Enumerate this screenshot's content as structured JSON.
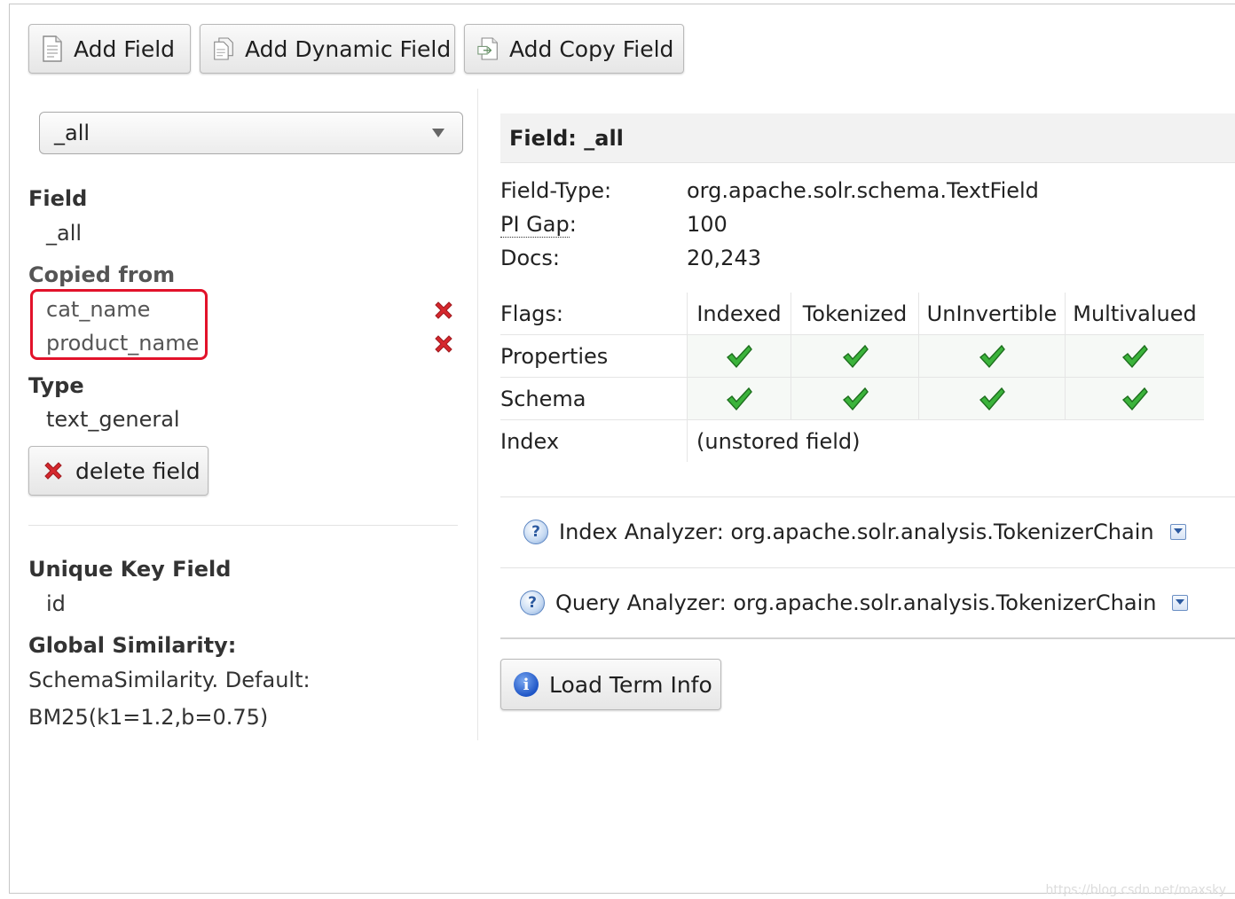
{
  "toolbar": {
    "add_field": "Add Field",
    "add_dynamic_field": "Add Dynamic Field",
    "add_copy_field": "Add Copy Field"
  },
  "field_select": {
    "selected": "_all"
  },
  "left": {
    "field_label": "Field",
    "field_value": "_all",
    "copied_from_label": "Copied from",
    "copied_from": [
      "cat_name",
      "product_name"
    ],
    "type_label": "Type",
    "type_value": "text_general",
    "delete_button": "delete field",
    "unique_key_label": "Unique Key Field",
    "unique_key_value": "id",
    "global_similarity_label": "Global Similarity:",
    "global_similarity_line1": "SchemaSimilarity. Default:",
    "global_similarity_line2": "BM25(k1=1.2,b=0.75)"
  },
  "detail": {
    "header": "Field: _all",
    "field_type_label": "Field-Type:",
    "field_type_value": "org.apache.solr.schema.TextField",
    "pi_gap_label": "PI Gap",
    "pi_gap_colon": ":",
    "pi_gap_value": "100",
    "docs_label": "Docs:",
    "docs_value": "20,243"
  },
  "flags": {
    "label": "Flags:",
    "columns": [
      "Indexed",
      "Tokenized",
      "UnInvertible",
      "Multivalued"
    ],
    "rows": [
      {
        "label": "Properties",
        "values": [
          true,
          true,
          true,
          true
        ]
      },
      {
        "label": "Schema",
        "values": [
          true,
          true,
          true,
          true
        ]
      }
    ],
    "index_label": "Index",
    "index_value": "(unstored field)"
  },
  "analyzers": {
    "index_label": "Index Analyzer:",
    "index_value": "org.apache.solr.analysis.TokenizerChain",
    "query_label": "Query Analyzer:",
    "query_value": "org.apache.solr.analysis.TokenizerChain"
  },
  "load_term_info": "Load Term Info",
  "watermark": "https://blog.csdn.net/maxsky",
  "colors": {
    "highlight": "#e2122a",
    "check": "#2fa52f"
  },
  "icons": {
    "add_field": "document-icon",
    "add_dynamic_field": "documents-icon",
    "add_copy_field": "copy-document-icon",
    "remove": "red-x-icon",
    "check": "checkmark-icon",
    "help": "question-icon",
    "toggle": "chevron-down-icon",
    "info": "info-icon"
  }
}
